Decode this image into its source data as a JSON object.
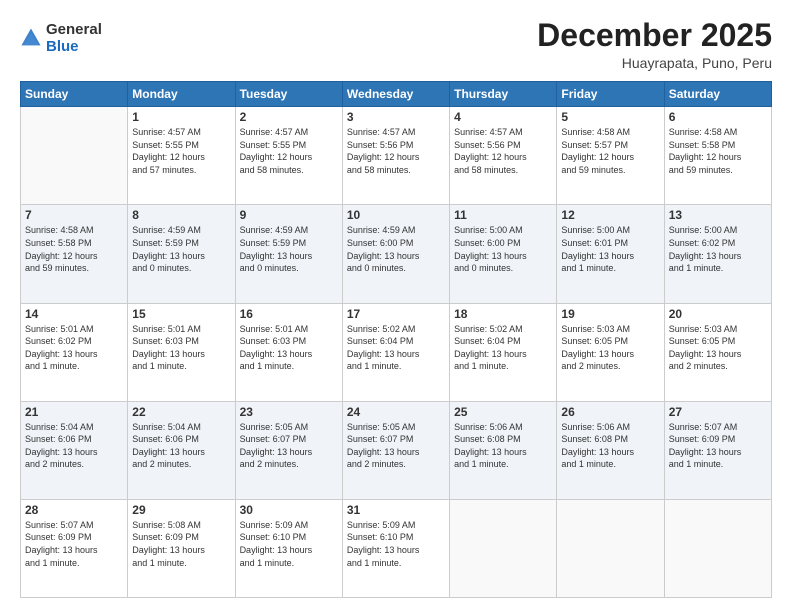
{
  "header": {
    "logo_general": "General",
    "logo_blue": "Blue",
    "title": "December 2025",
    "location": "Huayrapata, Puno, Peru"
  },
  "days_of_week": [
    "Sunday",
    "Monday",
    "Tuesday",
    "Wednesday",
    "Thursday",
    "Friday",
    "Saturday"
  ],
  "weeks": [
    [
      {
        "day": "",
        "info": ""
      },
      {
        "day": "1",
        "info": "Sunrise: 4:57 AM\nSunset: 5:55 PM\nDaylight: 12 hours\nand 57 minutes."
      },
      {
        "day": "2",
        "info": "Sunrise: 4:57 AM\nSunset: 5:55 PM\nDaylight: 12 hours\nand 58 minutes."
      },
      {
        "day": "3",
        "info": "Sunrise: 4:57 AM\nSunset: 5:56 PM\nDaylight: 12 hours\nand 58 minutes."
      },
      {
        "day": "4",
        "info": "Sunrise: 4:57 AM\nSunset: 5:56 PM\nDaylight: 12 hours\nand 58 minutes."
      },
      {
        "day": "5",
        "info": "Sunrise: 4:58 AM\nSunset: 5:57 PM\nDaylight: 12 hours\nand 59 minutes."
      },
      {
        "day": "6",
        "info": "Sunrise: 4:58 AM\nSunset: 5:58 PM\nDaylight: 12 hours\nand 59 minutes."
      }
    ],
    [
      {
        "day": "7",
        "info": "Sunrise: 4:58 AM\nSunset: 5:58 PM\nDaylight: 12 hours\nand 59 minutes."
      },
      {
        "day": "8",
        "info": "Sunrise: 4:59 AM\nSunset: 5:59 PM\nDaylight: 13 hours\nand 0 minutes."
      },
      {
        "day": "9",
        "info": "Sunrise: 4:59 AM\nSunset: 5:59 PM\nDaylight: 13 hours\nand 0 minutes."
      },
      {
        "day": "10",
        "info": "Sunrise: 4:59 AM\nSunset: 6:00 PM\nDaylight: 13 hours\nand 0 minutes."
      },
      {
        "day": "11",
        "info": "Sunrise: 5:00 AM\nSunset: 6:00 PM\nDaylight: 13 hours\nand 0 minutes."
      },
      {
        "day": "12",
        "info": "Sunrise: 5:00 AM\nSunset: 6:01 PM\nDaylight: 13 hours\nand 1 minute."
      },
      {
        "day": "13",
        "info": "Sunrise: 5:00 AM\nSunset: 6:02 PM\nDaylight: 13 hours\nand 1 minute."
      }
    ],
    [
      {
        "day": "14",
        "info": "Sunrise: 5:01 AM\nSunset: 6:02 PM\nDaylight: 13 hours\nand 1 minute."
      },
      {
        "day": "15",
        "info": "Sunrise: 5:01 AM\nSunset: 6:03 PM\nDaylight: 13 hours\nand 1 minute."
      },
      {
        "day": "16",
        "info": "Sunrise: 5:01 AM\nSunset: 6:03 PM\nDaylight: 13 hours\nand 1 minute."
      },
      {
        "day": "17",
        "info": "Sunrise: 5:02 AM\nSunset: 6:04 PM\nDaylight: 13 hours\nand 1 minute."
      },
      {
        "day": "18",
        "info": "Sunrise: 5:02 AM\nSunset: 6:04 PM\nDaylight: 13 hours\nand 1 minute."
      },
      {
        "day": "19",
        "info": "Sunrise: 5:03 AM\nSunset: 6:05 PM\nDaylight: 13 hours\nand 2 minutes."
      },
      {
        "day": "20",
        "info": "Sunrise: 5:03 AM\nSunset: 6:05 PM\nDaylight: 13 hours\nand 2 minutes."
      }
    ],
    [
      {
        "day": "21",
        "info": "Sunrise: 5:04 AM\nSunset: 6:06 PM\nDaylight: 13 hours\nand 2 minutes."
      },
      {
        "day": "22",
        "info": "Sunrise: 5:04 AM\nSunset: 6:06 PM\nDaylight: 13 hours\nand 2 minutes."
      },
      {
        "day": "23",
        "info": "Sunrise: 5:05 AM\nSunset: 6:07 PM\nDaylight: 13 hours\nand 2 minutes."
      },
      {
        "day": "24",
        "info": "Sunrise: 5:05 AM\nSunset: 6:07 PM\nDaylight: 13 hours\nand 2 minutes."
      },
      {
        "day": "25",
        "info": "Sunrise: 5:06 AM\nSunset: 6:08 PM\nDaylight: 13 hours\nand 1 minute."
      },
      {
        "day": "26",
        "info": "Sunrise: 5:06 AM\nSunset: 6:08 PM\nDaylight: 13 hours\nand 1 minute."
      },
      {
        "day": "27",
        "info": "Sunrise: 5:07 AM\nSunset: 6:09 PM\nDaylight: 13 hours\nand 1 minute."
      }
    ],
    [
      {
        "day": "28",
        "info": "Sunrise: 5:07 AM\nSunset: 6:09 PM\nDaylight: 13 hours\nand 1 minute."
      },
      {
        "day": "29",
        "info": "Sunrise: 5:08 AM\nSunset: 6:09 PM\nDaylight: 13 hours\nand 1 minute."
      },
      {
        "day": "30",
        "info": "Sunrise: 5:09 AM\nSunset: 6:10 PM\nDaylight: 13 hours\nand 1 minute."
      },
      {
        "day": "31",
        "info": "Sunrise: 5:09 AM\nSunset: 6:10 PM\nDaylight: 13 hours\nand 1 minute."
      },
      {
        "day": "",
        "info": ""
      },
      {
        "day": "",
        "info": ""
      },
      {
        "day": "",
        "info": ""
      }
    ]
  ]
}
